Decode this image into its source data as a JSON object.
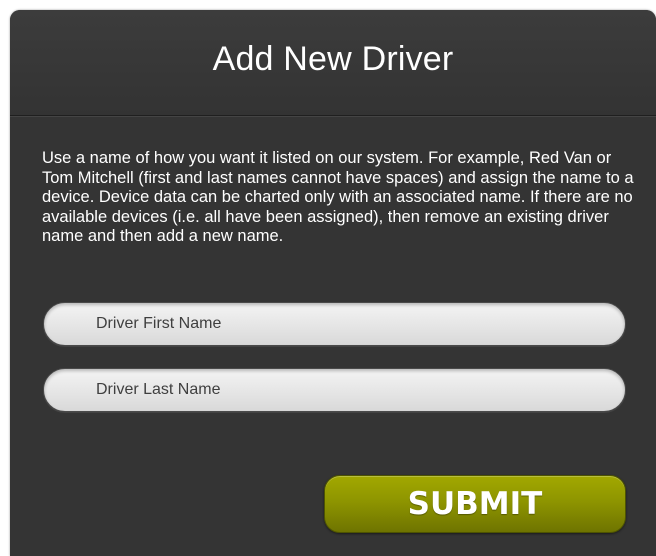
{
  "dialog": {
    "title": "Add New Driver",
    "description": "Use a name of how you want it listed on our system. For example, Red Van or Tom Mitchell (first and last names cannot have spaces) and assign the name to a device. Device data can be charted only with an associated name. If there are no available devices (i.e. all have been assigned), then remove an existing driver name and then add a new name."
  },
  "form": {
    "first_name": {
      "placeholder": "Driver First Name",
      "value": ""
    },
    "last_name": {
      "placeholder": "Driver Last Name",
      "value": ""
    },
    "submit_label": "SUBMIT"
  },
  "colors": {
    "dialog_background": "#343434",
    "submit_button": "#8e9500",
    "text": "#ffffff"
  }
}
